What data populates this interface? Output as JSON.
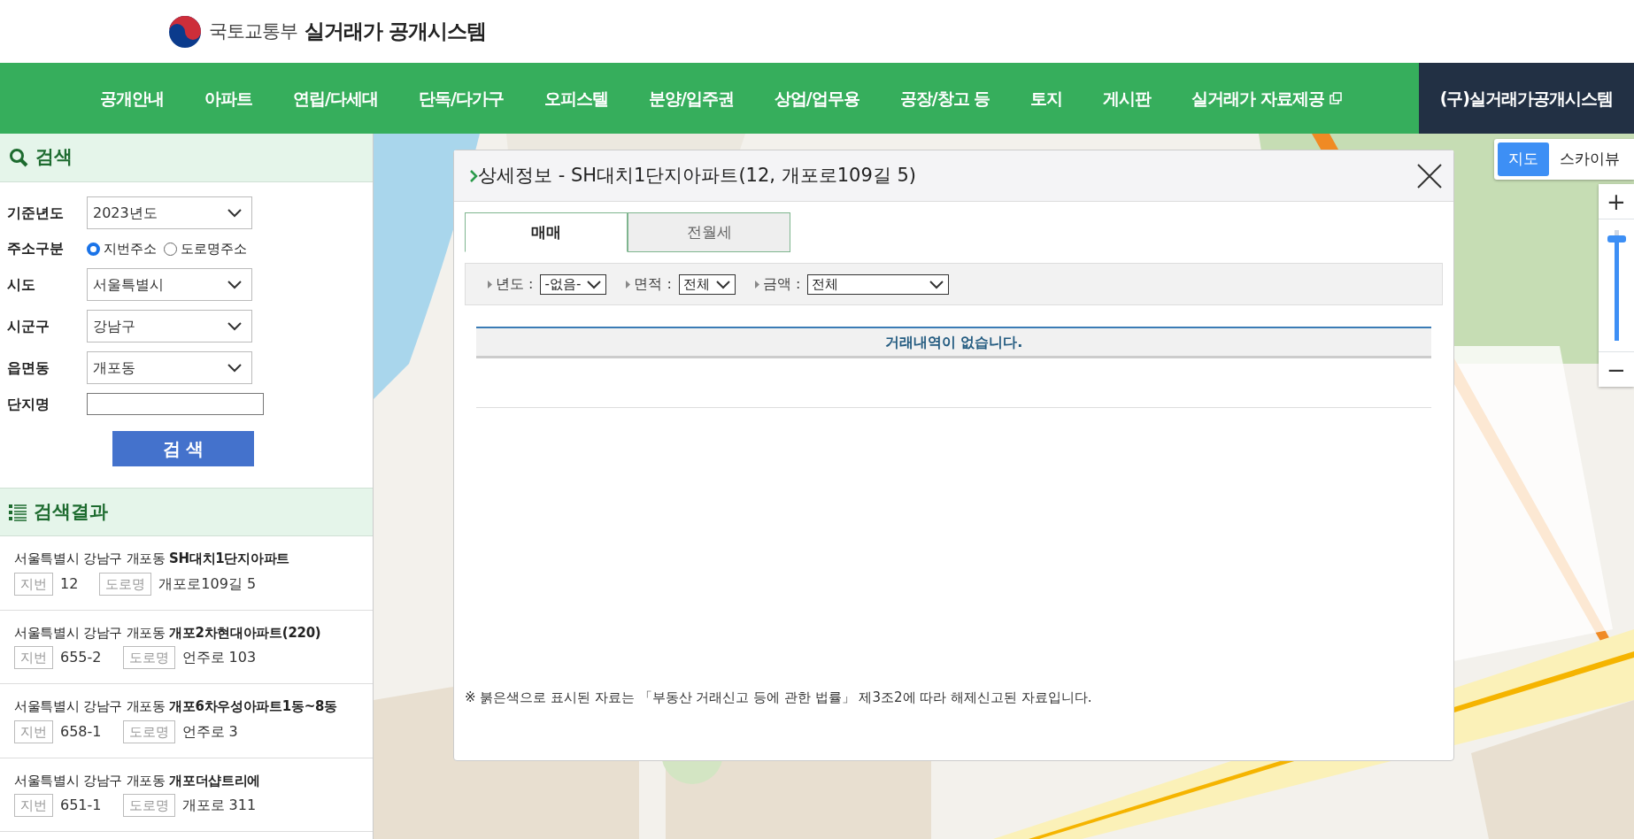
{
  "header": {
    "ministry": "국토교통부",
    "title": "실거래가 공개시스템"
  },
  "nav": [
    {
      "label": "공개안내",
      "kind": "link"
    },
    {
      "label": "아파트",
      "kind": "link"
    },
    {
      "label": "연립/다세대",
      "kind": "link"
    },
    {
      "label": "단독/다가구",
      "kind": "link"
    },
    {
      "label": "오피스텔",
      "kind": "link"
    },
    {
      "label": "분양/입주권",
      "kind": "link"
    },
    {
      "label": "상업/업무용",
      "kind": "link"
    },
    {
      "label": "공장/창고 등",
      "kind": "link"
    },
    {
      "label": "토지",
      "kind": "link"
    },
    {
      "label": "게시판",
      "kind": "link"
    },
    {
      "label": "실거래가 자료제공",
      "kind": "external"
    },
    {
      "label": "(구)실거래가공개시스템",
      "kind": "legacy"
    }
  ],
  "search": {
    "title": "검색",
    "fields": [
      {
        "kind": "select",
        "label": "기준년도",
        "value": "2023년도"
      },
      {
        "kind": "radio",
        "label": "주소구분",
        "options": [
          {
            "label": "지번주소",
            "selected": true
          },
          {
            "label": "도로명주소",
            "selected": false
          }
        ]
      },
      {
        "kind": "select",
        "label": "시도",
        "value": "서울특별시"
      },
      {
        "kind": "select",
        "label": "시군구",
        "value": "강남구"
      },
      {
        "kind": "select",
        "label": "읍면동",
        "value": "개포동"
      },
      {
        "kind": "text",
        "label": "단지명"
      }
    ],
    "button": "검 색"
  },
  "results": {
    "title": "검색결과",
    "items": [
      {
        "region": "서울특별시 강남구 개포동",
        "name": "SH대치1단지아파트",
        "jibun_label": "지번",
        "jibun": "12",
        "road_label": "도로명",
        "road": "개포로109길 5"
      },
      {
        "region": "서울특별시 강남구 개포동",
        "name": "개포2차현대아파트(220)",
        "jibun_label": "지번",
        "jibun": "655-2",
        "road_label": "도로명",
        "road": "언주로 103"
      },
      {
        "region": "서울특별시 강남구 개포동",
        "name": "개포6차우성아파트1동~8동",
        "jibun_label": "지번",
        "jibun": "658-1",
        "road_label": "도로명",
        "road": "언주로 3"
      },
      {
        "region": "서울특별시 강남구 개포동",
        "name": "개포더샵트리에",
        "jibun_label": "지번",
        "jibun": "651-1",
        "road_label": "도로명",
        "road": "개포로 311"
      }
    ]
  },
  "dialog": {
    "title": "상세정보 - SH대치1단지아파트(12, 개포로109길 5)",
    "tabs": [
      {
        "label": "매매",
        "selected": true
      },
      {
        "label": "전월세",
        "selected": false
      }
    ],
    "filters": [
      {
        "label": "년도 :",
        "value": "-없음-",
        "kind": "compact"
      },
      {
        "label": "면적 :",
        "value": "전체",
        "kind": "compact"
      },
      {
        "label": "금액 :",
        "value": "전체",
        "kind": "wide"
      }
    ],
    "empty_message": "거래내역이 없습니다.",
    "footnote": "※ 붉은색으로 표시된 자료는 「부동산 거래신고 등에 관한 법률」 제3조2에 따라 해제신고된 자료입니다."
  },
  "map_controls": {
    "view_toggle": [
      {
        "label": "지도",
        "selected": true
      },
      {
        "label": "스카이뷰",
        "selected": false
      }
    ],
    "zoom": {
      "plus": "+",
      "minus": "−",
      "level": 0.92
    }
  }
}
